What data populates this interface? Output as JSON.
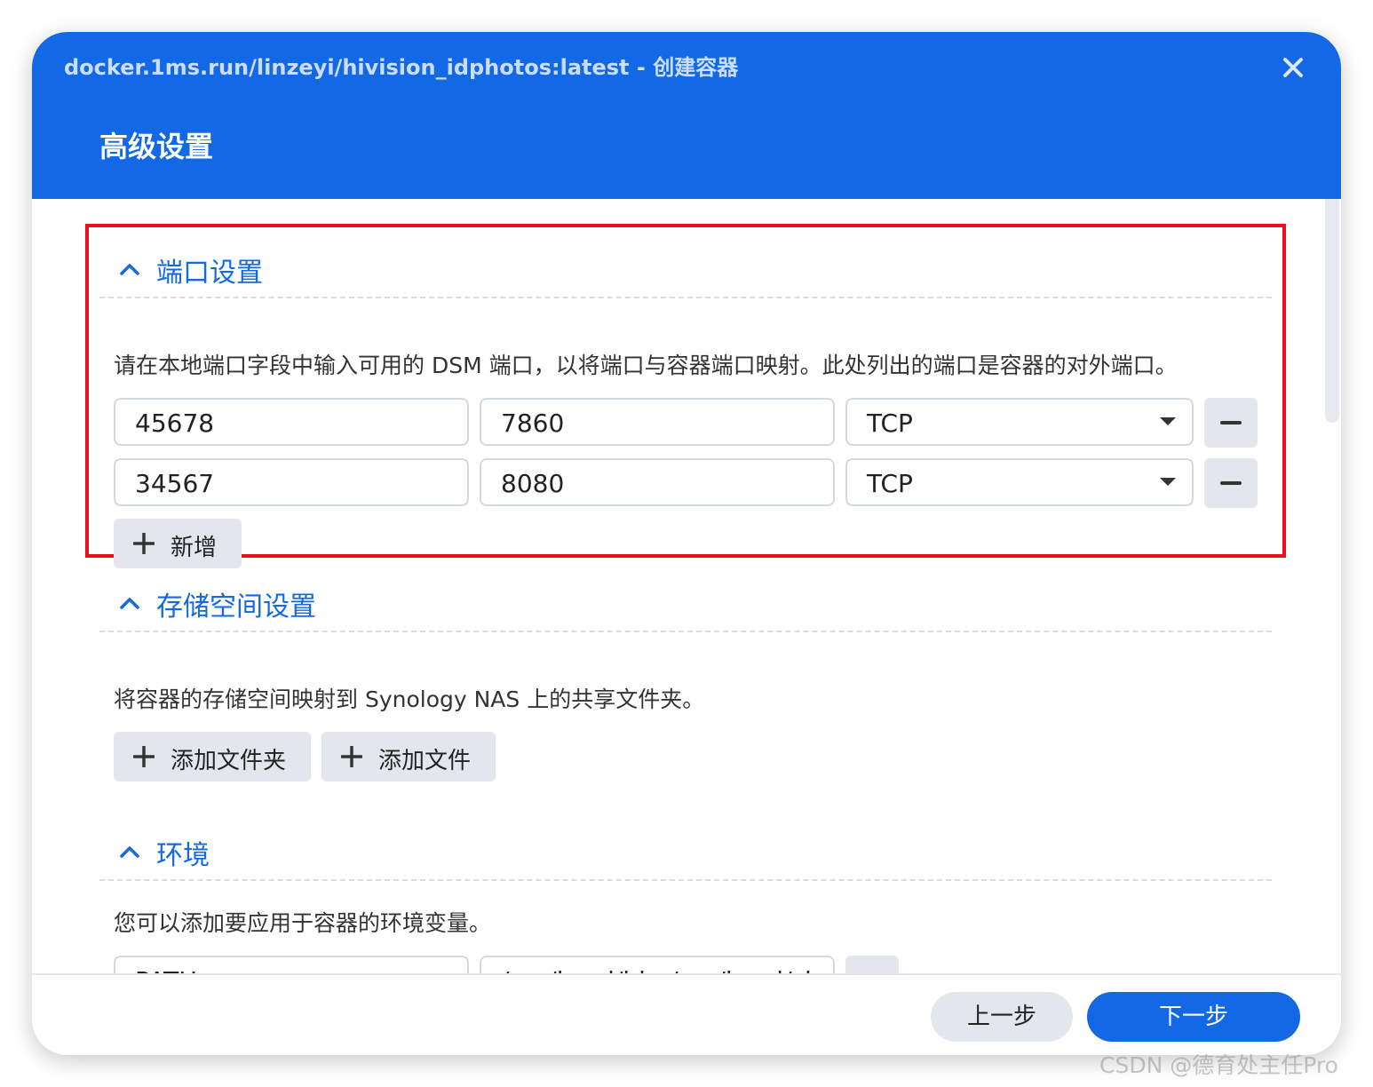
{
  "window": {
    "title": "docker.1ms.run/linzeyi/hivision_idphotos:latest - 创建容器",
    "page_title": "高级设置"
  },
  "ports": {
    "title": "端口设置",
    "description": "请在本地端口字段中输入可用的 DSM 端口，以将端口与容器端口映射。此处列出的端口是容器的对外端口。",
    "rows": [
      {
        "local": "45678",
        "container": "7860",
        "protocol": "TCP"
      },
      {
        "local": "34567",
        "container": "8080",
        "protocol": "TCP"
      }
    ],
    "add_label": "新增"
  },
  "storage": {
    "title": "存储空间设置",
    "description": "将容器的存储空间映射到 Synology NAS 上的共享文件夹。",
    "add_folder_label": "添加文件夹",
    "add_file_label": "添加文件"
  },
  "env": {
    "title": "环境",
    "description": "您可以添加要应用于容器的环境变量。",
    "rows": [
      {
        "name": "PATH",
        "value": "/usr/local/bin:/usr/local/sb"
      }
    ]
  },
  "footer": {
    "prev_label": "上一步",
    "next_label": "下一步"
  },
  "watermark": "CSDN @德育处主任Pro",
  "colors": {
    "accent": "#1268e5",
    "highlight_border": "#ee0f1c",
    "button_gray": "#e3e7ed"
  },
  "icons": {
    "close": "close-icon",
    "collapse": "chevron-up-icon",
    "add": "plus-icon",
    "remove": "minus-icon",
    "dropdown": "caret-down-icon"
  }
}
